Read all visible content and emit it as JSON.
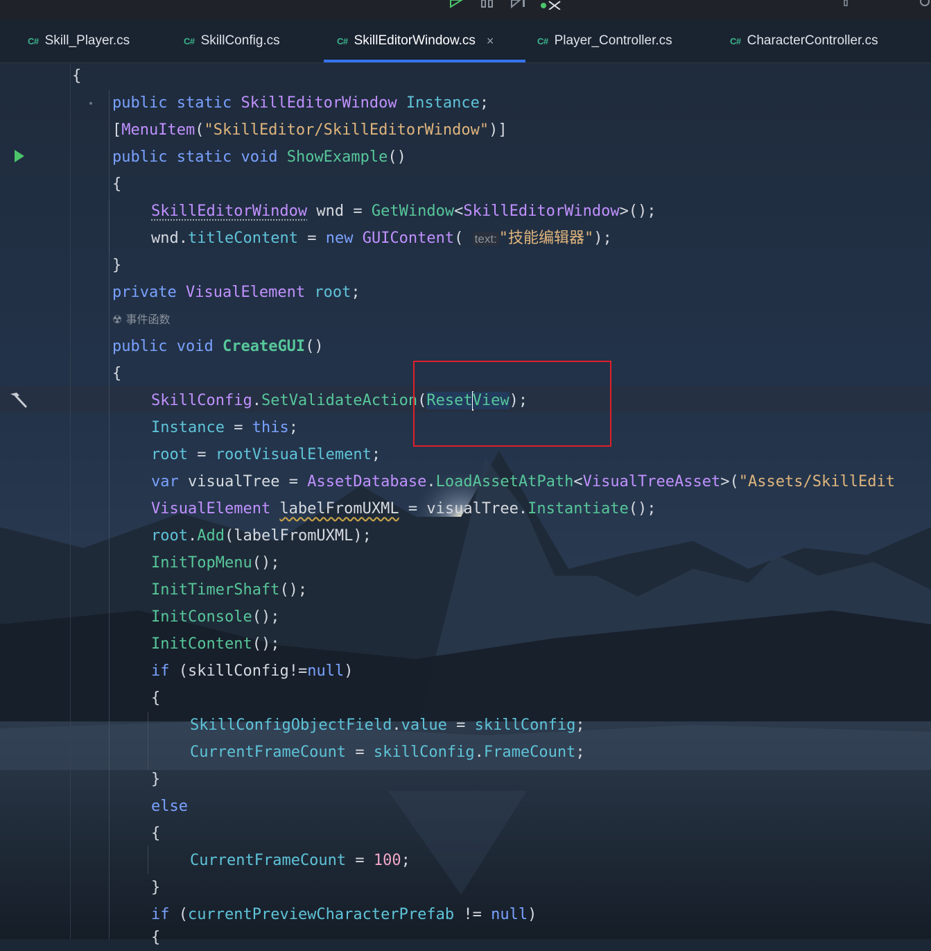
{
  "colors": {
    "keyword": "#7aa2ff",
    "type": "#c191ff",
    "method": "#57c79a",
    "property": "#5fc4d9",
    "string": "#e0b57c",
    "number": "#f2a7c8",
    "tab_accent": "#3574f0",
    "annotation_box": "#e02028"
  },
  "toolbar": {
    "icons": [
      "run-icon",
      "pause-icon",
      "step-icon",
      "debug-icon"
    ]
  },
  "tabs": [
    {
      "lang": "C#",
      "label": "Skill_Player.cs",
      "active": false
    },
    {
      "lang": "C#",
      "label": "SkillConfig.cs",
      "active": false
    },
    {
      "lang": "C#",
      "label": "SkillEditorWindow.cs",
      "active": true,
      "close": "×"
    },
    {
      "lang": "C#",
      "label": "Player_Controller.cs",
      "active": false
    },
    {
      "lang": "C#",
      "label": "CharacterController.cs",
      "active": false
    }
  ],
  "editor": {
    "codelens_label": "事件函数",
    "param_hint": "text:",
    "current_line": 13,
    "code": {
      "l1": {
        "brace": "{"
      },
      "l2": {
        "public": "public",
        "static": "static",
        "type": "SkillEditorWindow",
        "name": "Instance",
        "end": ";"
      },
      "l3": {
        "open": "[",
        "attr": "MenuItem",
        "paren_open": "(",
        "str": "\"SkillEditor/SkillEditorWindow\"",
        "close": ")]"
      },
      "l4": {
        "public": "public",
        "static": "static",
        "void": "void",
        "method": "ShowExample",
        "parens": "()"
      },
      "l5": {
        "brace": "{"
      },
      "l6": {
        "type": "SkillEditorWindow",
        "var": "wnd",
        "eq": "=",
        "method": "GetWindow",
        "lt": "<",
        "type2": "SkillEditorWindow",
        "tail": ">();"
      },
      "l7": {
        "obj": "wnd",
        "dot": ".",
        "prop": "titleContent",
        "eq": "=",
        "new": "new",
        "type": "GUIContent",
        "paren": "(",
        "str": "\"技能编辑器\"",
        "tail": ");"
      },
      "l8": {
        "brace": "}"
      },
      "l9": {
        "private": "private",
        "type": "VisualElement",
        "name": "root",
        "end": ";"
      },
      "l11": {
        "public": "public",
        "void": "void",
        "method": "CreateGUI",
        "parens": "()"
      },
      "l12": {
        "brace": "{"
      },
      "l13": {
        "type": "SkillConfig",
        "dot": ".",
        "method": "SetValidateAction",
        "paren": "(",
        "arg_a": "Reset",
        "arg_b": "View",
        "tail": ");"
      },
      "l14": {
        "prop": "Instance",
        "eq": "=",
        "this": "this",
        "end": ";"
      },
      "l15": {
        "name": "root",
        "eq": "=",
        "prop": "rootVisualElement",
        "end": ";"
      },
      "l16": {
        "var": "var",
        "name": "visualTree",
        "eq": "=",
        "type": "AssetDatabase",
        "dot": ".",
        "method": "LoadAssetAtPath",
        "lt": "<",
        "type2": "VisualTreeAsset",
        "tail": ">(",
        "str": "\"Assets/SkillEdit"
      },
      "l17": {
        "type": "VisualElement",
        "name": "labelFromUXML",
        "eq": "=",
        "obj": "visualTree",
        "dot": ".",
        "method": "Instantiate",
        "tail": "();"
      },
      "l18": {
        "obj": "root",
        "dot": ".",
        "method": "Add",
        "tail": "(labelFromUXML);"
      },
      "l19": {
        "method": "InitTopMenu",
        "tail": "();"
      },
      "l20": {
        "method": "InitTimerShaft",
        "tail": "();"
      },
      "l21": {
        "method": "InitConsole",
        "tail": "();"
      },
      "l22": {
        "method": "InitContent",
        "tail": "();"
      },
      "l23": {
        "if": "if",
        "open": "(",
        "name": "skillConfig",
        "op": "!=",
        "null": "null",
        "close": ")"
      },
      "l24": {
        "brace": "{"
      },
      "l25": {
        "prop": "SkillConfigObjectField",
        "dot": ".",
        "prop2": "value",
        "eq": "=",
        "prop3": "skillConfig",
        "end": ";"
      },
      "l26": {
        "prop": "CurrentFrameCount",
        "eq": "=",
        "prop2": "skillConfig",
        "dot": ".",
        "prop3": "FrameCount",
        "end": ";"
      },
      "l27": {
        "brace": "}"
      },
      "l28": {
        "else": "else"
      },
      "l29": {
        "brace": "{"
      },
      "l30": {
        "prop": "CurrentFrameCount",
        "eq": "=",
        "num": "100",
        "end": ";"
      },
      "l31": {
        "brace": "}"
      },
      "l32": {
        "if": "if",
        "open": "(",
        "prop": "currentPreviewCharacterPrefab",
        "op": "!=",
        "null": "null",
        "close": ")"
      },
      "l33": {
        "brace": "{"
      }
    }
  }
}
